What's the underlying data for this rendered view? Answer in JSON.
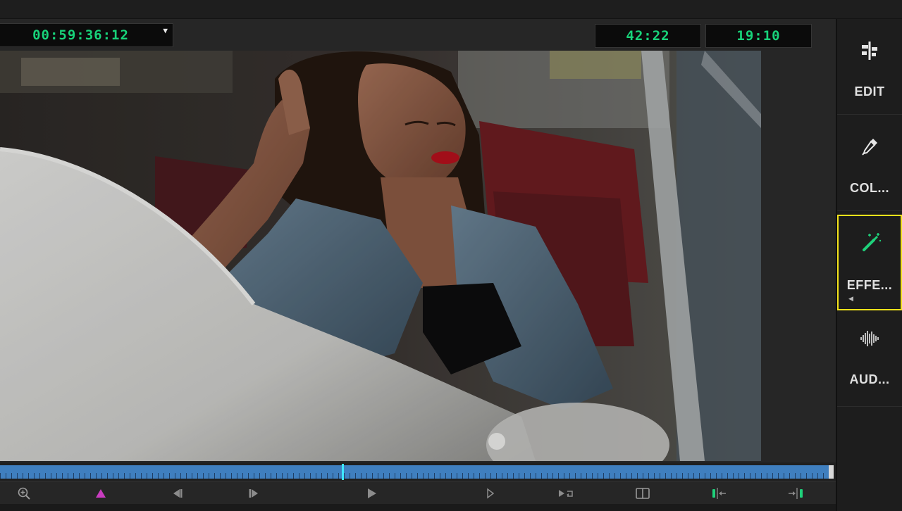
{
  "viewer": {
    "timecode_current": "00:59:36:12",
    "timecode_duration": "42:22",
    "timecode_end": "19:10"
  },
  "scrubber": {
    "progress": 0.41
  },
  "transport": {
    "buttons": [
      {
        "name": "zoom-button",
        "icon": "zoom-in-icon"
      },
      {
        "name": "marker-button",
        "icon": "marker-icon"
      },
      {
        "name": "previous-edit-button",
        "icon": "step-back-icon"
      },
      {
        "name": "next-edit-button",
        "icon": "step-forward-icon"
      },
      {
        "name": "play-button",
        "icon": "play-icon"
      },
      {
        "name": "play-around-button",
        "icon": "play-outline-icon"
      },
      {
        "name": "loop-button",
        "icon": "loop-icon"
      },
      {
        "name": "compare-view-button",
        "icon": "split-view-icon"
      },
      {
        "name": "trim-in-button",
        "icon": "trim-in-icon"
      },
      {
        "name": "trim-out-button",
        "icon": "trim-out-icon"
      }
    ]
  },
  "sidebar": {
    "items": [
      {
        "label": "EDIT",
        "icon": "edit-icon"
      },
      {
        "label": "COL...",
        "icon": "eyedropper-icon"
      },
      {
        "label": "EFFE...",
        "icon": "magic-wand-icon",
        "active": true
      },
      {
        "label": "AUD...",
        "icon": "waveform-icon"
      }
    ]
  },
  "colors": {
    "timecode": "#18d37a",
    "scrub_track": "#3f7fbf",
    "playhead": "#3ee7ff",
    "active_outline": "#f4e31a",
    "accent_green": "#1fd07a",
    "marker": "#c93cc0"
  }
}
